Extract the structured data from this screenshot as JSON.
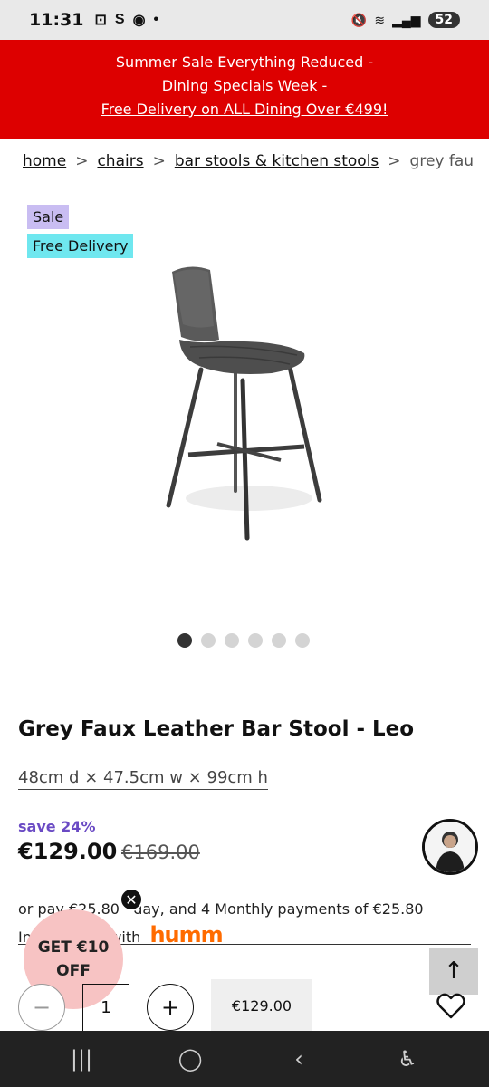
{
  "status_bar": {
    "time": "11:31",
    "left_icons": [
      "screenshot-icon",
      "s-app-icon",
      "messenger-icon",
      "dot-icon"
    ],
    "right_icons": [
      "mute-icon",
      "wifi-icon",
      "signal-icon"
    ],
    "battery": "52"
  },
  "promo": {
    "line1": "Summer Sale Everything Reduced -",
    "line2": "Dining Specials Week -",
    "link": "Free Delivery on ALL Dining Over €499!"
  },
  "breadcrumb": {
    "items": [
      "home",
      "chairs",
      "bar stools & kitchen stools"
    ],
    "separator": ">",
    "current": "grey fau…"
  },
  "badges": {
    "sale": "Sale",
    "delivery": "Free Delivery"
  },
  "carousel": {
    "total": 6,
    "active": 1
  },
  "product": {
    "title": "Grey Faux Leather Bar Stool - Leo",
    "dimensions": "48cm d × 47.5cm w × 99cm h",
    "save": "save 24%",
    "price": "€129.00",
    "old_price": "€169.00"
  },
  "payments": {
    "line1_a": "or pay €25.80",
    "line1_b": "day, and 4 Monthly payments of €25.80",
    "line2_a": "In",
    "line2_b": "with",
    "brand": "humm"
  },
  "discount": {
    "line1": "GET €10",
    "line2": "OFF",
    "close": "✕"
  },
  "scroll_top": "↑",
  "quantity": {
    "minus": "−",
    "value": "1",
    "plus": "+"
  },
  "add_to_cart": {
    "price": "€129.00"
  },
  "nav": {
    "recents": "|||",
    "home": "◯",
    "back": "‹",
    "accessibility": "♿"
  },
  "colors": {
    "promo_bg": "#dd0000",
    "sale_badge": "#c9bdf2",
    "delivery_badge": "#6fe7ef",
    "save_text": "#6a4ac4",
    "humm": "#ff6b00"
  }
}
